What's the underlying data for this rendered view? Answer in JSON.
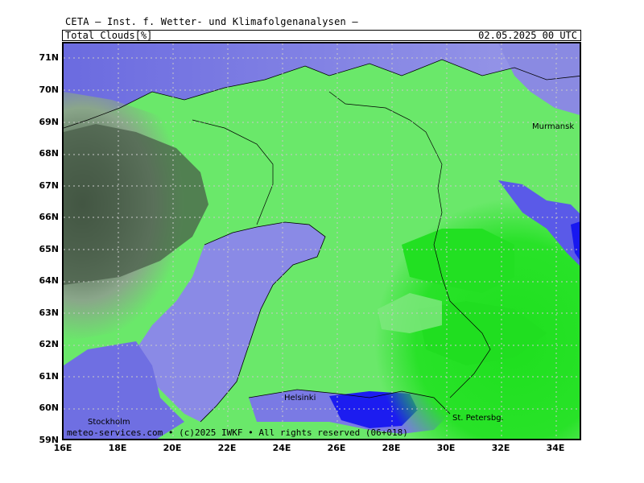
{
  "header": {
    "title": "CETA – Inst. f. Wetter- und Klimafolgenanalysen –",
    "parameter": "Total_Clouds[%]",
    "datetime": "02.05.2025 00 UTC"
  },
  "footer": {
    "copyright": "meteo-services.com • (c)2025 IWKF • All rights reserved (06+018)"
  },
  "axes": {
    "lat_labels": [
      "71N",
      "70N",
      "69N",
      "68N",
      "67N",
      "66N",
      "65N",
      "64N",
      "63N",
      "62N",
      "61N",
      "60N",
      "59N"
    ],
    "lon_labels": [
      "16E",
      "18E",
      "20E",
      "22E",
      "24E",
      "26E",
      "28E",
      "30E",
      "32E",
      "34E"
    ]
  },
  "cities": [
    {
      "name": "Murmansk"
    },
    {
      "name": "Helsinki"
    },
    {
      "name": "St. Petersbg."
    },
    {
      "name": "Stockholm"
    }
  ],
  "colors": {
    "clear_green": "#1ee01e",
    "light_green": "#5ae85a",
    "pale_green": "#8cec8c",
    "periwinkle": "#8080e0",
    "deep_blue": "#1818f0",
    "dark_gray": "#3a4a3a",
    "gray_green": "#7a9a7a",
    "grid": "#c0c0c0"
  }
}
